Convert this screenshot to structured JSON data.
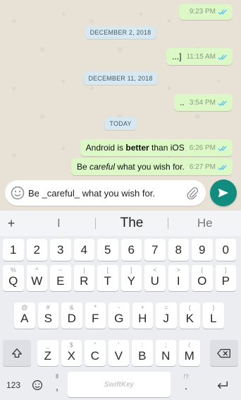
{
  "chat": {
    "messages": [
      {
        "text": "",
        "time": "9:23 PM"
      },
      {
        "text": "...]",
        "time": "11:15 AM"
      },
      {
        "text": "..",
        "time": "3:54 PM"
      },
      {
        "text_before": "Android is ",
        "text_bold": "better",
        "text_after": " than iOS",
        "time": "6:26 PM"
      },
      {
        "text_before": "Be ",
        "text_italic": "careful",
        "text_after": " what you wish for.",
        "time": "6:27 PM"
      }
    ],
    "dates": [
      "DECEMBER 2, 2018",
      "DECEMBER 11, 2018",
      "TODAY"
    ]
  },
  "composer": {
    "value": "Be _careful_ what you wish for.",
    "emoji_icon": "emoji-icon",
    "attach_icon": "paperclip-icon",
    "send_icon": "send-icon",
    "send_color": "#128c7e"
  },
  "keyboard": {
    "suggestions": {
      "plus": "+",
      "left": "I",
      "center": "The",
      "right": "He"
    },
    "number_row": [
      "1",
      "2",
      "3",
      "4",
      "5",
      "6",
      "7",
      "8",
      "9",
      "0"
    ],
    "row1": [
      {
        "key": "Q",
        "hint": "%"
      },
      {
        "key": "W",
        "hint": "^"
      },
      {
        "key": "E",
        "hint": "~"
      },
      {
        "key": "R",
        "hint": "|"
      },
      {
        "key": "T",
        "hint": "["
      },
      {
        "key": "Y",
        "hint": "]"
      },
      {
        "key": "U",
        "hint": "<"
      },
      {
        "key": "I",
        "hint": ">"
      },
      {
        "key": "O",
        "hint": "{"
      },
      {
        "key": "P",
        "hint": "}"
      }
    ],
    "row2": [
      {
        "key": "A",
        "hint": "@"
      },
      {
        "key": "S",
        "hint": "#"
      },
      {
        "key": "D",
        "hint": "&"
      },
      {
        "key": "F",
        "hint": "*"
      },
      {
        "key": "G",
        "hint": "-"
      },
      {
        "key": "H",
        "hint": "+"
      },
      {
        "key": "J",
        "hint": "="
      },
      {
        "key": "K",
        "hint": "("
      },
      {
        "key": "L",
        "hint": ")"
      }
    ],
    "row3": [
      {
        "key": "Z",
        "hint": "_"
      },
      {
        "key": "X",
        "hint": "$"
      },
      {
        "key": "C",
        "hint": "\""
      },
      {
        "key": "V",
        "hint": "'"
      },
      {
        "key": "B",
        "hint": ":"
      },
      {
        "key": "N",
        "hint": ";"
      },
      {
        "key": "M",
        "hint": "/"
      }
    ],
    "bottom": {
      "mode": "123",
      "comma": ",",
      "space_label": "SwiftKey",
      "period": ".",
      "period_hint": "!?"
    }
  }
}
